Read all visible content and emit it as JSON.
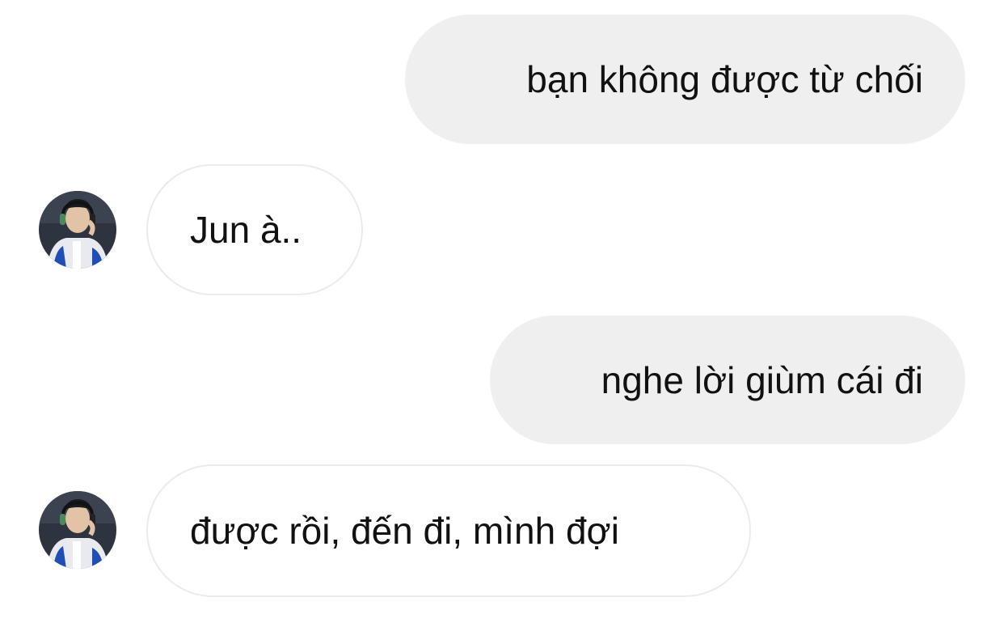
{
  "messages": [
    {
      "direction": "sent",
      "text": "bạn không được từ chối"
    },
    {
      "direction": "received",
      "text": "Jun à..",
      "avatar_icon": "user-avatar-icon"
    },
    {
      "direction": "sent",
      "text": "nghe lời giùm cái đi"
    },
    {
      "direction": "received",
      "text": "được rồi, đến đi, mình đợi",
      "avatar_icon": "user-avatar-icon"
    }
  ],
  "colors": {
    "sent_bubble": "#efefef",
    "received_bubble": "#ffffff",
    "received_border": "#ebebeb",
    "text": "#111111"
  }
}
